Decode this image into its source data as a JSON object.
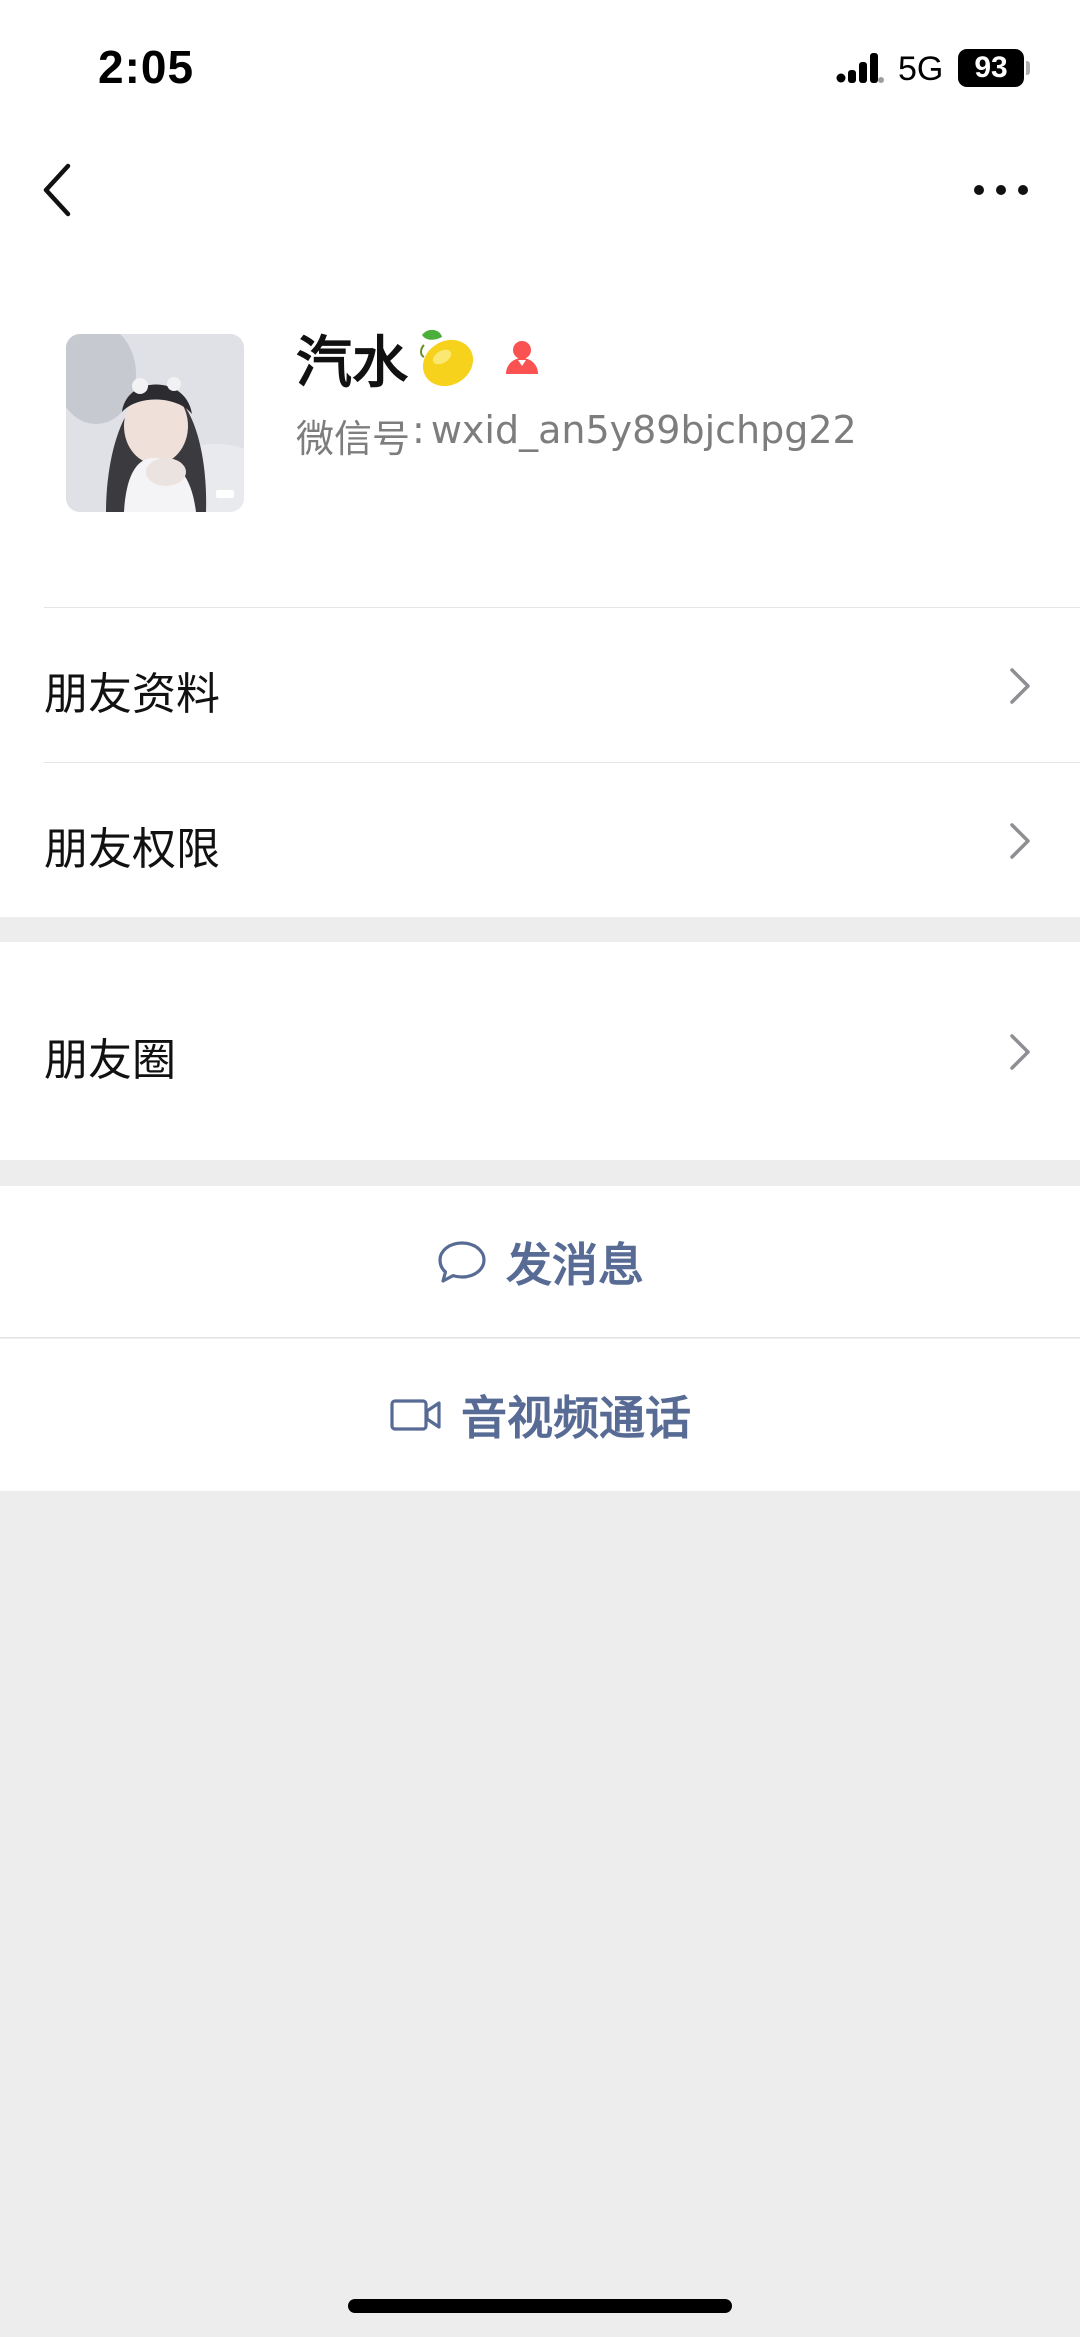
{
  "status_bar": {
    "time": "2:05",
    "network": "5G",
    "battery": "93",
    "icons": [
      "signal-icon",
      "battery-icon"
    ]
  },
  "nav": {
    "icons": [
      "back-arrow-icon",
      "more-icon"
    ]
  },
  "profile": {
    "name": "汽水",
    "name_emoji": "lemon-icon",
    "gender_icon": "female-icon",
    "gender_color": "#fa5151",
    "wechat_id_label": "微信号",
    "wechat_id_sep": ":",
    "wechat_id": "wxid_an5y89bjchpg22"
  },
  "menu": {
    "friend_info": "朋友资料",
    "friend_permissions": "朋友权限",
    "moments": "朋友圈"
  },
  "actions": {
    "send_message": "发消息",
    "send_message_icon": "chat-bubble-icon",
    "av_call": "音视频通话",
    "av_call_icon": "video-camera-icon"
  },
  "colors": {
    "link_blue": "#576b95",
    "background_gray": "#ededed"
  }
}
